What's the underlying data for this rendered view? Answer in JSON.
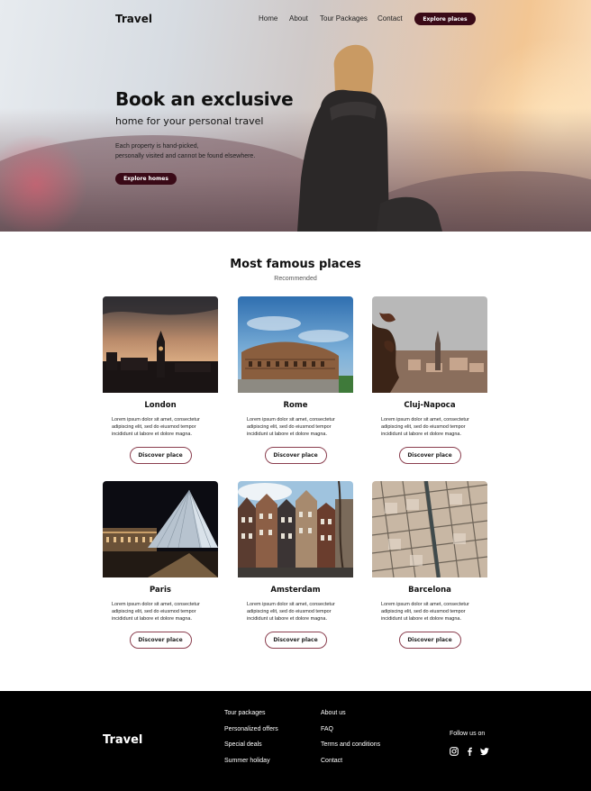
{
  "header": {
    "logo": "Travel",
    "nav": [
      "Home",
      "About",
      "Tour Packages",
      "Contact"
    ],
    "cta": "Explore places"
  },
  "hero": {
    "title": "Book an exclusive",
    "subtitle": "home for your personal travel",
    "description_line1": "Each property is hand-picked,",
    "description_line2": "personally visited and cannot be found elsewhere.",
    "button": "Explore homes"
  },
  "places": {
    "title": "Most famous places",
    "subtitle": "Recommended",
    "cards": [
      {
        "city": "London",
        "desc": "Lorem ipsum dolor sit amet, consectetur adipiscing elit, sed do eiusmod tempor incididunt ut labore et dolore magna.",
        "button": "Discover place"
      },
      {
        "city": "Rome",
        "desc": "Lorem ipsum dolor sit amet, consectetur adipiscing elit, sed do eiusmod tempor incididunt ut labore et dolore magna.",
        "button": "Discover place"
      },
      {
        "city": "Cluj-Napoca",
        "desc": "Lorem ipsum dolor sit amet, consectetur adipiscing elit, sed do eiusmod tempor incididunt ut labore et dolore magna.",
        "button": "Discover place"
      },
      {
        "city": "Paris",
        "desc": "Lorem ipsum dolor sit amet, consectetur adipiscing elit, sed do eiusmod tempor incididunt ut labore et dolore magna.",
        "button": "Discover place"
      },
      {
        "city": "Amsterdam",
        "desc": "Lorem ipsum dolor sit amet, consectetur adipiscing elit, sed do eiusmod tempor incididunt ut labore et dolore magna.",
        "button": "Discover place"
      },
      {
        "city": "Barcelona",
        "desc": "Lorem ipsum dolor sit amet, consectetur adipiscing elit, sed do eiusmod tempor incididunt ut labore et dolore magna.",
        "button": "Discover place"
      }
    ]
  },
  "footer": {
    "logo": "Travel",
    "col1": [
      "Tour packages",
      "Personalized offers",
      "Special deals",
      "Summer holiday"
    ],
    "col2": [
      "About us",
      "FAQ",
      "Terms and conditions",
      "Contact"
    ],
    "follow": "Follow us on",
    "socials": [
      "instagram-icon",
      "facebook-icon",
      "twitter-icon"
    ]
  },
  "colors": {
    "accent": "#3a0a17",
    "card_button_border": "#8a3e4e",
    "footer_bg": "#000000"
  }
}
